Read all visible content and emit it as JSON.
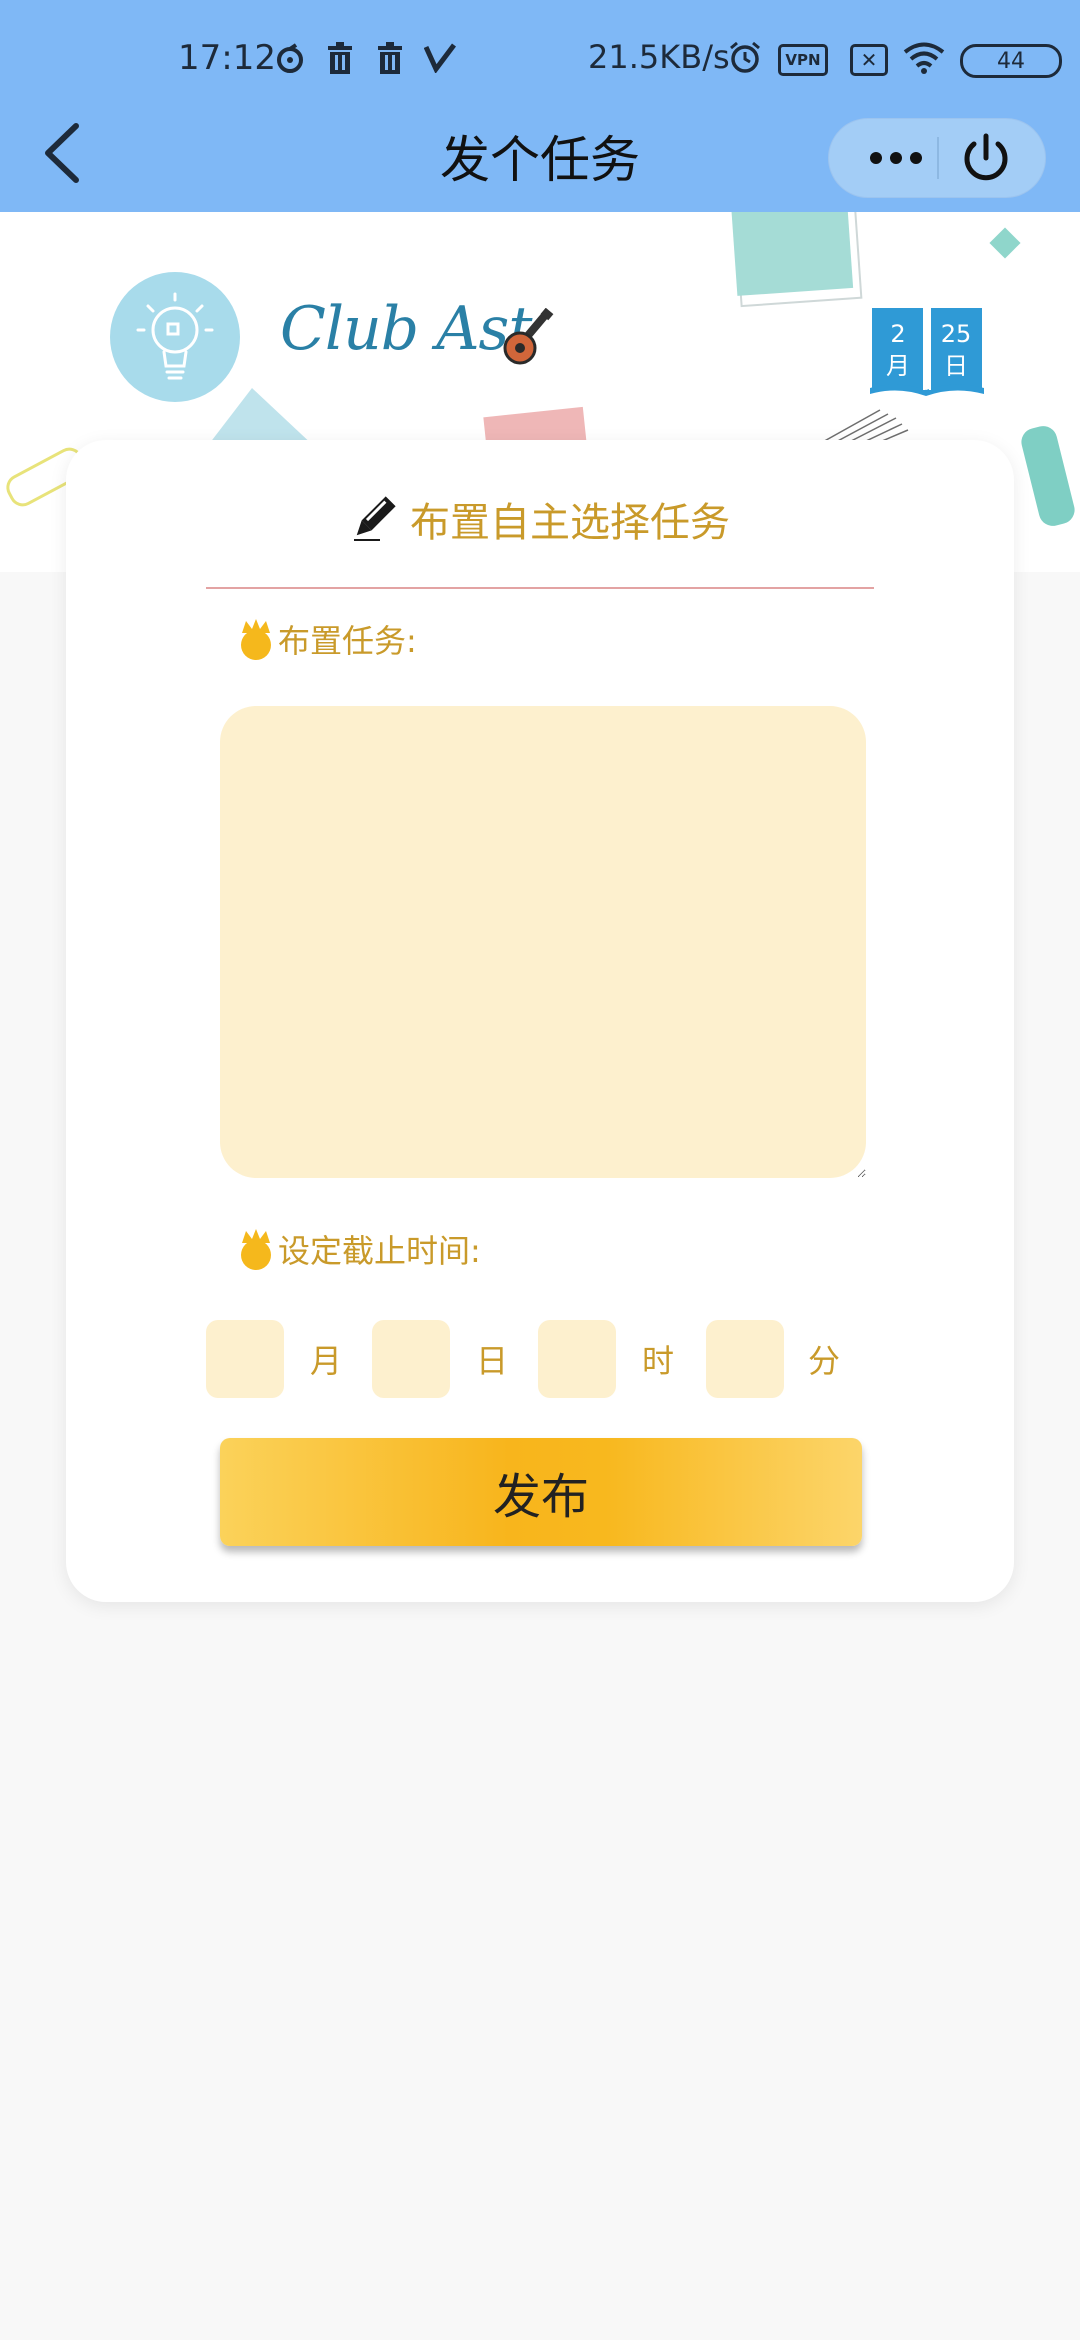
{
  "status_bar": {
    "time": "17:12",
    "net_speed": "21.5KB/s",
    "vpn": "VPN",
    "battery": "44",
    "icons": [
      "sync-icon",
      "trash-icon",
      "trash-icon",
      "v-icon",
      "alarm-icon",
      "vpn-icon",
      "sim-off-icon",
      "wifi-icon",
      "battery-icon"
    ]
  },
  "nav": {
    "title": "发个任务",
    "back_icon": "chevron-left-icon",
    "more_label": "•••",
    "close_icon": "power-icon"
  },
  "banner": {
    "club_text": "Club Ast",
    "calendar": {
      "month": "2",
      "month_label": "月",
      "day": "25",
      "day_label": "日"
    }
  },
  "card": {
    "title": "布置自主选择任务",
    "task_label": "布置任务:",
    "deadline_label": "设定截止时间:",
    "time_units": {
      "month": "月",
      "day": "日",
      "hour": "时",
      "minute": "分"
    },
    "publish_label": "发布"
  },
  "colors": {
    "nav_bg": "#7fb8f6",
    "accent_text": "#c99a2a",
    "input_bg": "#fdf0ce",
    "button": "#f8b51c"
  }
}
